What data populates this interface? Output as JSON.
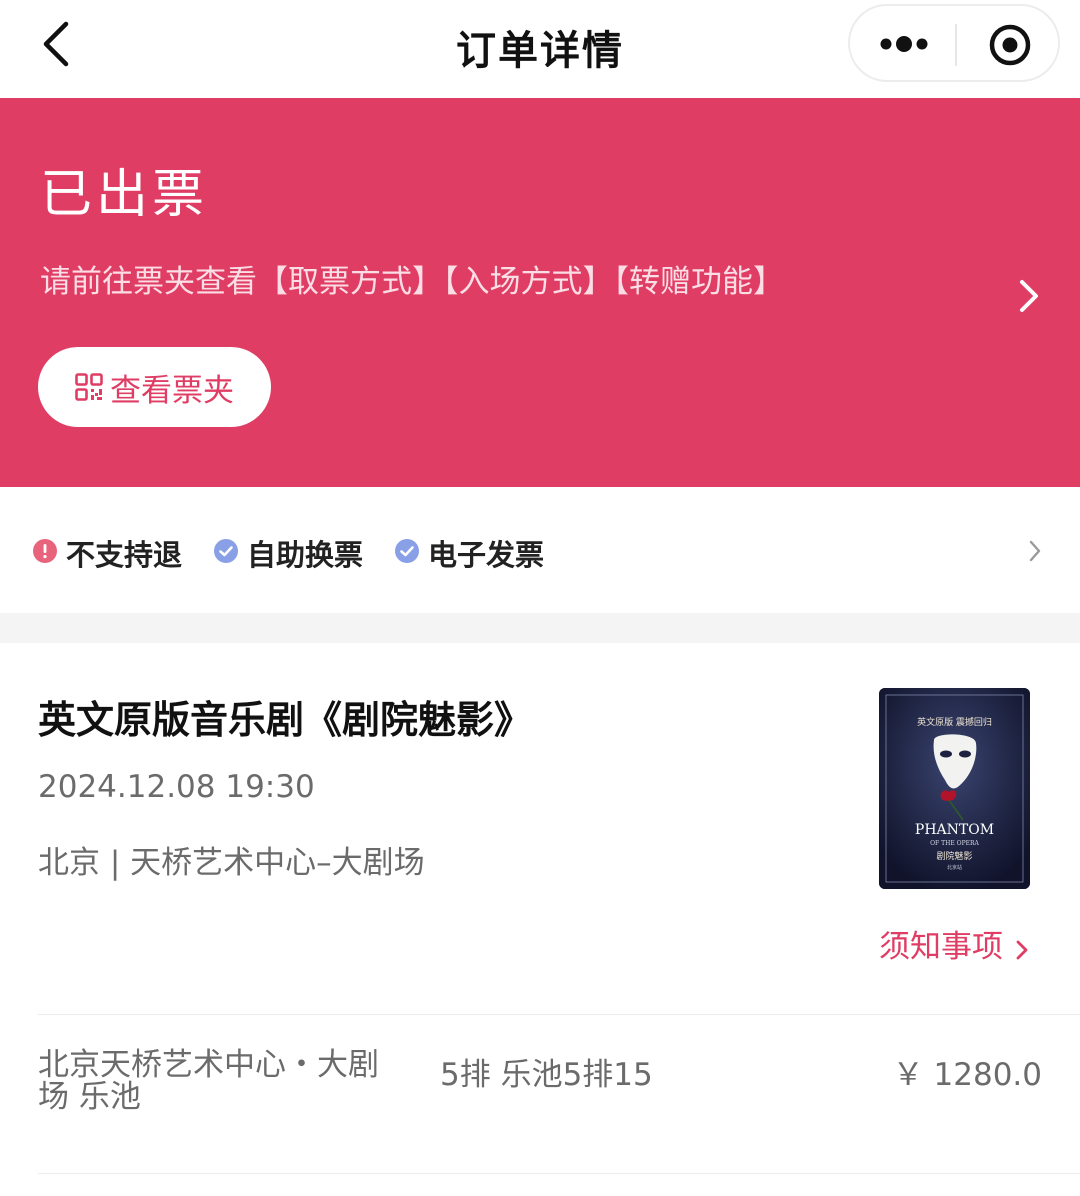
{
  "nav": {
    "title": "订单详情",
    "back_icon": "chevron-left-icon",
    "more_icon": "more-dots-icon",
    "close_icon": "target-circle-icon"
  },
  "banner": {
    "status": "已出票",
    "tip": "请前往票夹查看【取票方式】【入场方式】【转赠功能】",
    "wallet_button": "查看票夹",
    "bg_color": "#e03d64"
  },
  "policies": [
    {
      "label": "不支持退",
      "icon": "alert-circle-icon",
      "color": "#e8647c"
    },
    {
      "label": "自助换票",
      "icon": "check-circle-icon",
      "color": "#8aa0e6"
    },
    {
      "label": "电子发票",
      "icon": "check-circle-icon",
      "color": "#8aa0e6"
    }
  ],
  "show": {
    "title": "英文原版音乐剧《剧院魅影》",
    "datetime": "2024.12.08 19:30",
    "venue": "北京 | 天桥艺术中心–大剧场",
    "notice": "须知事项",
    "poster": {
      "top_text": "英文原版 震撼回归",
      "title_en": "PHANTOM",
      "subtitle_en": "OF THE OPERA",
      "title_cn": "剧院魅影",
      "city": "北京站"
    }
  },
  "ticket": {
    "area": "北京天桥艺术中心・大剧场 乐池",
    "seat": "5排 乐池5排15",
    "price": "￥ 1280.0"
  }
}
